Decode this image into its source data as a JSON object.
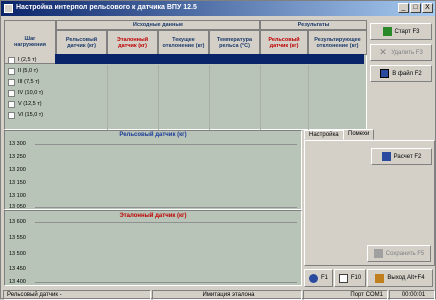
{
  "window": {
    "title": "Настройка интерпол рельсового к датчика ВПУ 12.5",
    "minimize": "_",
    "maximize": "□",
    "close": "X"
  },
  "grid": {
    "step_header": "Шаг\nнагружения",
    "group_source": "Исходные данные",
    "group_results": "Результаты",
    "columns": [
      "Рельсовый датчик (кг)",
      "Эталонный датчик (кг)",
      "Текущее отклонение (кг)",
      "Температура рельса (°С)",
      "Рельсовый датчик (кг)",
      "Результирующее отклонение (кг)"
    ],
    "steps": [
      "I (2,5 т)",
      "II (5,0 т)",
      "III (7,5 т)",
      "IV (10,0 т)",
      "V (12,5 т)",
      "VI (15,0 т)"
    ]
  },
  "buttons": {
    "start": "Старт F3",
    "delete": "Удалить F3",
    "file": "В файл F2",
    "calculate": "Расчет F2",
    "save": "Сохранить F5",
    "help": "F1",
    "f10": "F10",
    "exit": "Выход Alt+F4"
  },
  "tabs": [
    "Настройка",
    "Помехи"
  ],
  "charts": [
    {
      "title": "Рельсовый датчик (кг)",
      "ticks": [
        "13 300",
        "13 250",
        "13 200",
        "13 150",
        "13 100",
        "13 050"
      ]
    },
    {
      "title": "Эталонный датчик (кг)",
      "ticks": [
        "13 600",
        "13 550",
        "13 500",
        "13 450",
        "13 400"
      ]
    }
  ],
  "status": {
    "left": "Рельсовый датчик -",
    "middle": "Имитация эталона",
    "port": "Порт COM1",
    "time": "00:00:01"
  },
  "colors": {
    "title_bar": "#0a246a",
    "grid_bg": "#b8c4b8",
    "selected_row": "#0a246a",
    "header_blue": "#1a3a6a",
    "header_red": "#c00000"
  }
}
